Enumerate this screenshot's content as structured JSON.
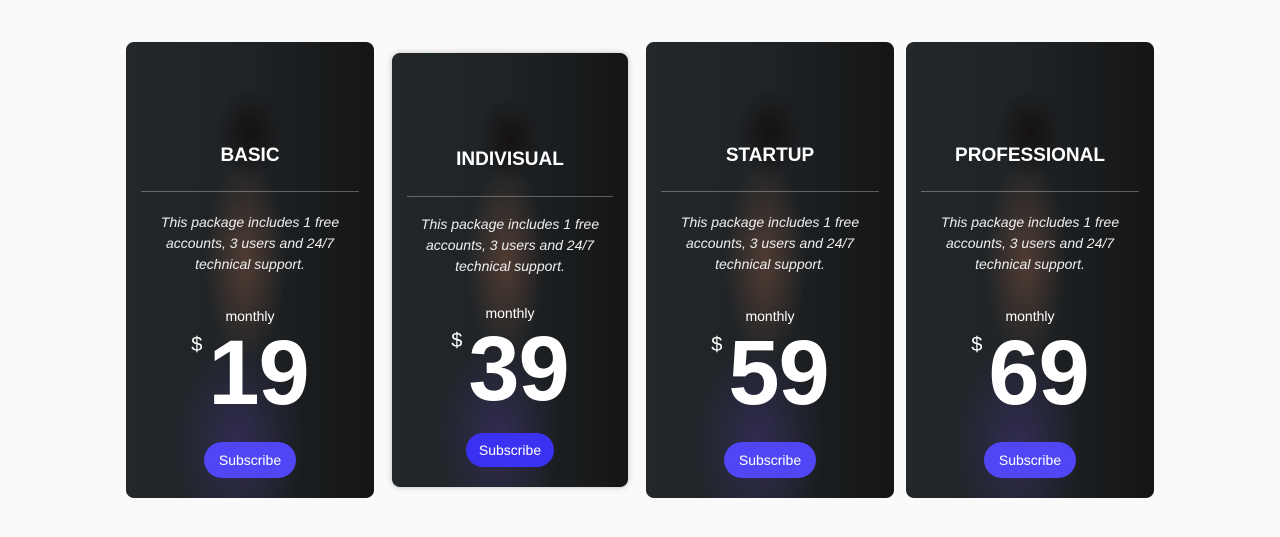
{
  "plans": [
    {
      "name": "BASIC",
      "description": "This package includes 1 free accounts, 3 users and 24/7 technical support.",
      "period": "monthly",
      "currency": "$",
      "price": "19",
      "button": "Subscribe"
    },
    {
      "name": "INDIVISUAL",
      "description": "This package includes 1 free accounts, 3 users and 24/7 technical support.",
      "period": "monthly",
      "currency": "$",
      "price": "39",
      "button": "Subscribe"
    },
    {
      "name": "STARTUP",
      "description": "This package includes 1 free accounts, 3 users and 24/7 technical support.",
      "period": "monthly",
      "currency": "$",
      "price": "59",
      "button": "Subscribe"
    },
    {
      "name": "PROFESSIONAL",
      "description": "This package includes 1 free accounts, 3 users and 24/7 technical support.",
      "period": "monthly",
      "currency": "$",
      "price": "69",
      "button": "Subscribe"
    }
  ],
  "colors": {
    "button": "#5046f5",
    "button_featured": "#3a32f0",
    "page_bg": "#fafafa"
  }
}
